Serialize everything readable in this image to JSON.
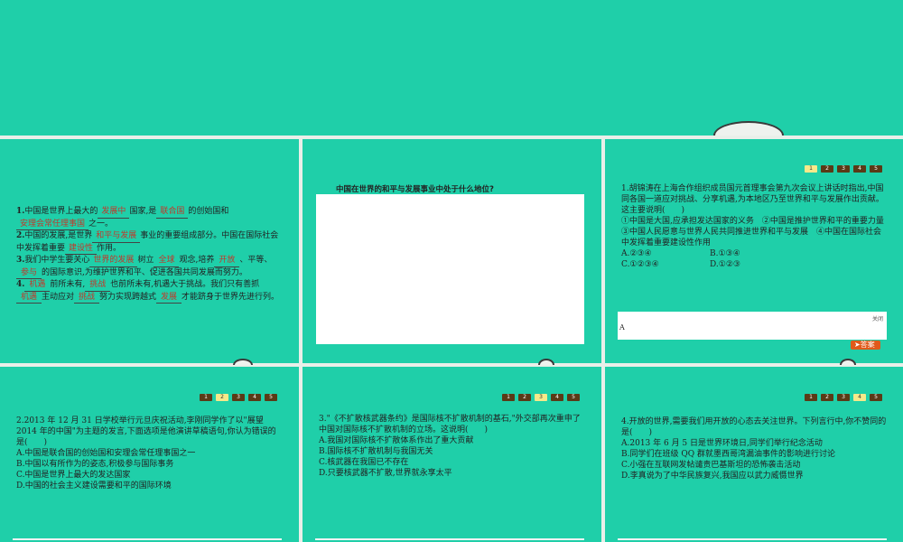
{
  "panel1": {
    "items": [
      {
        "num": "1.",
        "parts": [
          "中国是世界上最大的",
          "国家,是",
          "的创始国和",
          "之一。"
        ],
        "blanks": [
          "发展中",
          "联合国",
          "安理会常任理事国"
        ]
      },
      {
        "num": "2.",
        "parts": [
          "中国的发展,是世界",
          "事业的重要组成部分。中国在国际社会中发挥着重要",
          "作用。"
        ],
        "blanks": [
          "和平与发展",
          "建设性"
        ]
      },
      {
        "num": "3.",
        "parts": [
          "我们中学生要关心",
          "树立",
          "观念,培养",
          "、平等、",
          "的国际意识,为维护世界和平、促进各国共同发展而努力。"
        ],
        "blanks": [
          "世界的发展",
          "全球",
          "开放",
          "参与"
        ]
      },
      {
        "num": "4.",
        "parts": [
          "前所未有,",
          "也前所未有,机遇大于挑战。我们只有善抓",
          "主动应对",
          "努力实现跨越式",
          "才能跻身于世界先进行列。"
        ],
        "blanks": [
          "机遇",
          "挑战",
          "机遇",
          "挑战",
          "发展"
        ]
      }
    ]
  },
  "panel2": {
    "question": "中国在世界的和平与发展事业中处于什么地位?"
  },
  "panel3": {
    "nav": [
      "1",
      "2",
      "3",
      "4",
      "5"
    ],
    "active": 0,
    "question": "1.胡锦涛在上海合作组织成员国元首理事会第九次会议上讲话时指出,中国同各国一道应对挑战、分享机遇,为本地区乃至世界和平与发展作出贡献。这主要说明(　　)",
    "statements": "①中国是大国,应承担发达国家的义务　②中国是推护世界和平的重要力量　③中国人民愿意与世界人民共同推进世界和平与发展　④中国在国际社会中发挥着重要建设性作用",
    "options": [
      "A.②③④",
      "B.①③④",
      "C.①②③④",
      "D.①②③"
    ],
    "close_label": "关闭",
    "answer_value": "A",
    "answer_button": "答案"
  },
  "panel4": {
    "nav": [
      "1",
      "2",
      "3",
      "4",
      "5"
    ],
    "active": 1,
    "question": "2.2013 年 12 月 31 日学校举行元旦庆祝活动,李刚同学作了以\"展望 2014 年的中国\"为主题的发言,下面选项是他演讲草稿语句,你认为错误的是(　　)",
    "options": [
      "A.中国是联合国的创始国和安理会常任理事国之一",
      "B.中国以有所作为的姿态,积极参与国际事务",
      "C.中国是世界上最大的发达国家",
      "D.中国的社会主义建设需要和平的国际环境"
    ]
  },
  "panel5": {
    "nav": [
      "1",
      "2",
      "3",
      "4",
      "5"
    ],
    "active": 2,
    "question": "3.\"《不扩散核武器条约》是国际核不扩散机制的基石,\"外交部再次重申了中国对国际核不扩散机制的立场。这说明(　　)",
    "options": [
      "A.我国对国际核不扩散体系作出了重大贡献",
      "B.国际核不扩散机制与我国无关",
      "C.核武器在我国已不存在",
      "D.只要核武器不扩散,世界就永享太平"
    ]
  },
  "panel6": {
    "nav": [
      "1",
      "2",
      "3",
      "4",
      "5"
    ],
    "active": 3,
    "question": "4.开放的世界,需要我们用开放的心态去关注世界。下列言行中,你不赞同的是(　　)",
    "options": [
      "A.2013 年 6 月 5 日是世界环境日,同学们举行纪念活动",
      "B.同学们在班级 QQ 群就墨西哥湾漏油事件的影响进行讨论",
      "C.小强在互联网发帖谴责巴基斯坦的恐怖袭击活动",
      "D.李真说为了中华民族复兴,我国应以武力威慑世界"
    ]
  }
}
